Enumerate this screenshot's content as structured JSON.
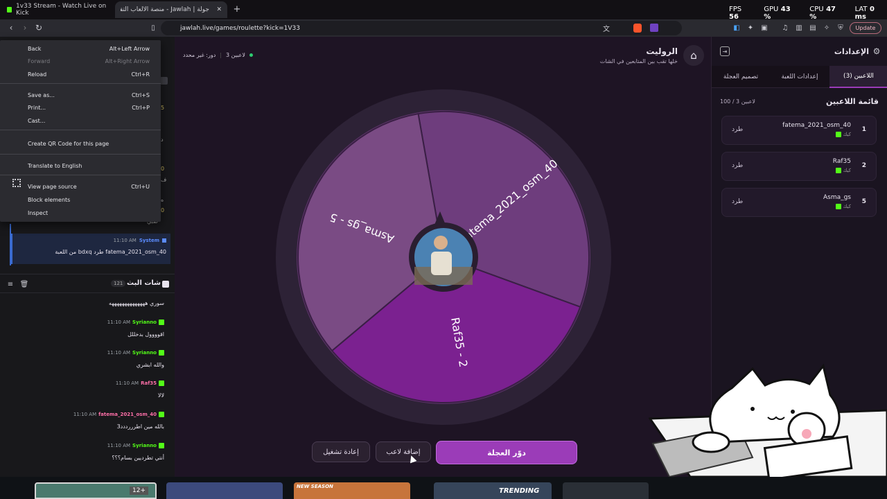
{
  "browser": {
    "tabs": [
      {
        "title": "1v33 Stream - Watch Live on Kick"
      },
      {
        "title": "جولة | Jawlah - منصة الألعاب التفا"
      }
    ],
    "new_tab": "+",
    "url": "jawlah.live/games/roulette?kick=1V33",
    "update_label": "Update",
    "hud": {
      "fps_label": "FPS",
      "fps": "56",
      "gpu_label": "GPU",
      "gpu": "43 %",
      "cpu_label": "CPU",
      "cpu": "47 %",
      "lat_label": "LAT",
      "lat": "0 ms"
    }
  },
  "context_menu": {
    "items": [
      {
        "label": "Back",
        "shortcut": "Alt+Left Arrow"
      },
      {
        "label": "Forward",
        "shortcut": "Alt+Right Arrow"
      },
      {
        "label": "Reload",
        "shortcut": "Ctrl+R"
      },
      {
        "label": "Save as...",
        "shortcut": "Ctrl+S"
      },
      {
        "label": "Print...",
        "shortcut": "Ctrl+P"
      },
      {
        "label": "Cast...",
        "shortcut": ""
      },
      {
        "label": "Create QR Code for this page",
        "shortcut": ""
      },
      {
        "label": "Translate to English",
        "shortcut": ""
      },
      {
        "label": "View page source",
        "shortcut": "Ctrl+U"
      },
      {
        "label": "Block elements",
        "shortcut": ""
      },
      {
        "label": "Inspect",
        "shortcut": ""
      }
    ]
  },
  "chat": {
    "system_msg": {
      "time": "11:10 AM",
      "name": "System",
      "text": "fatema_2021_osm_40 طرد bdxq من اللعبة"
    },
    "partial_glyphs": [
      "5",
      "د",
      "0",
      "ف",
      "0",
      "ه",
      "ضبي"
    ],
    "header": {
      "title": "شات البث",
      "count": "121"
    },
    "messages": [
      {
        "time": "",
        "name": "",
        "text": "سوري ههههههههههههههه"
      },
      {
        "time": "11:10 AM",
        "name": "Syrianno",
        "text": "اقوووول بدخللل"
      },
      {
        "time": "11:10 AM",
        "name": "Syrianno",
        "text": "والله ابشري"
      },
      {
        "time": "11:10 AM",
        "name": "Raf35",
        "text": "لالا"
      },
      {
        "time": "11:10 AM",
        "name": "fatema_2021_osm_40",
        "text": "بالله مين اطرررددد3"
      },
      {
        "time": "11:10 AM",
        "name": "Syrianno",
        "text": "أنتي تطرديين بسام؟؟؟"
      }
    ]
  },
  "game": {
    "title": "الروليت",
    "subtitle": "خلها تقب بين المتابعين في الشات",
    "players_count": "3 لاعبين",
    "turn_status": "دور: غير محدد",
    "wheel": {
      "segments": [
        {
          "label": "fatema_2021_osm_40",
          "color": "#6e3d7d"
        },
        {
          "label": "Raf35 - 2",
          "color": "#7b2190"
        },
        {
          "label": "Asma_gs - 5",
          "color": "#7a4b84"
        }
      ]
    },
    "buttons": {
      "restart": "إعادة تشغيل",
      "add_player": "إضافة لاعب",
      "spin": "دوّر العجلة"
    }
  },
  "settings": {
    "title": "الإعدادات",
    "tabs": {
      "players": "اللاعبين (3)",
      "game": "إعدادات اللعبة",
      "wheel": "تصميم العجلة"
    },
    "list_title": "قائمة اللاعبين",
    "list_count": "100 / 3 لاعبين",
    "players": [
      {
        "num": "1",
        "name": "fatema_2021_osm_40",
        "platform": "كيك",
        "kick": "طرد"
      },
      {
        "num": "2",
        "name": "Raf35",
        "platform": "كيك",
        "kick": "طرد"
      },
      {
        "num": "5",
        "name": "Asma_gs",
        "platform": "كيك",
        "kick": "طرد"
      }
    ]
  },
  "taskbar": {
    "badge": "12+",
    "new_season": "NEW SEASON",
    "trending": "TRENDING"
  },
  "colors": {
    "accent": "#9b3cb8",
    "kick_green": "#53fc18"
  }
}
